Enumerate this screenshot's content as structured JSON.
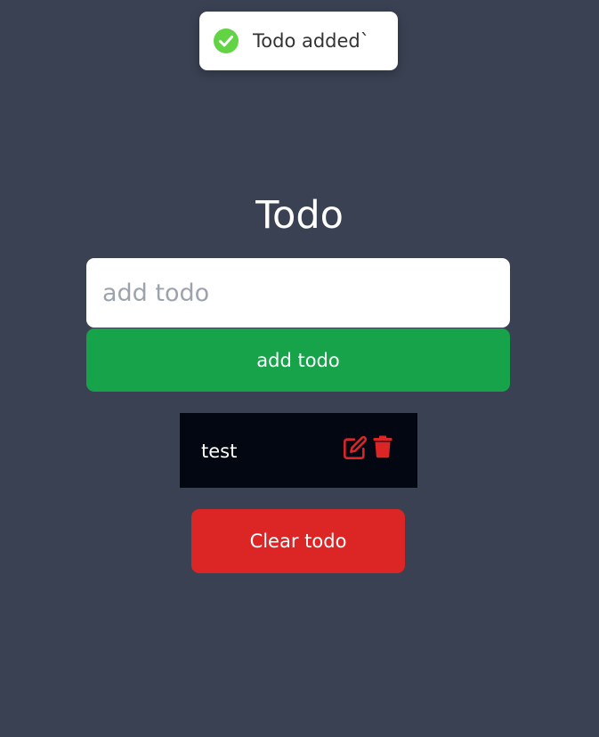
{
  "toast": {
    "message": "Todo added`",
    "icon": "check-circle-icon",
    "icon_color": "#61d345"
  },
  "header": {
    "title": "Todo"
  },
  "form": {
    "input_placeholder": "add todo",
    "input_value": "",
    "add_button_label": "add todo",
    "add_button_color": "#16a34a"
  },
  "todos": [
    {
      "text": "test",
      "edit_icon": "edit-icon",
      "delete_icon": "trash-icon",
      "icon_color": "#dc2626"
    }
  ],
  "footer": {
    "clear_button_label": "Clear todo",
    "clear_button_color": "#dc2626"
  },
  "colors": {
    "background": "#394152",
    "todo_item_background": "#030712"
  }
}
